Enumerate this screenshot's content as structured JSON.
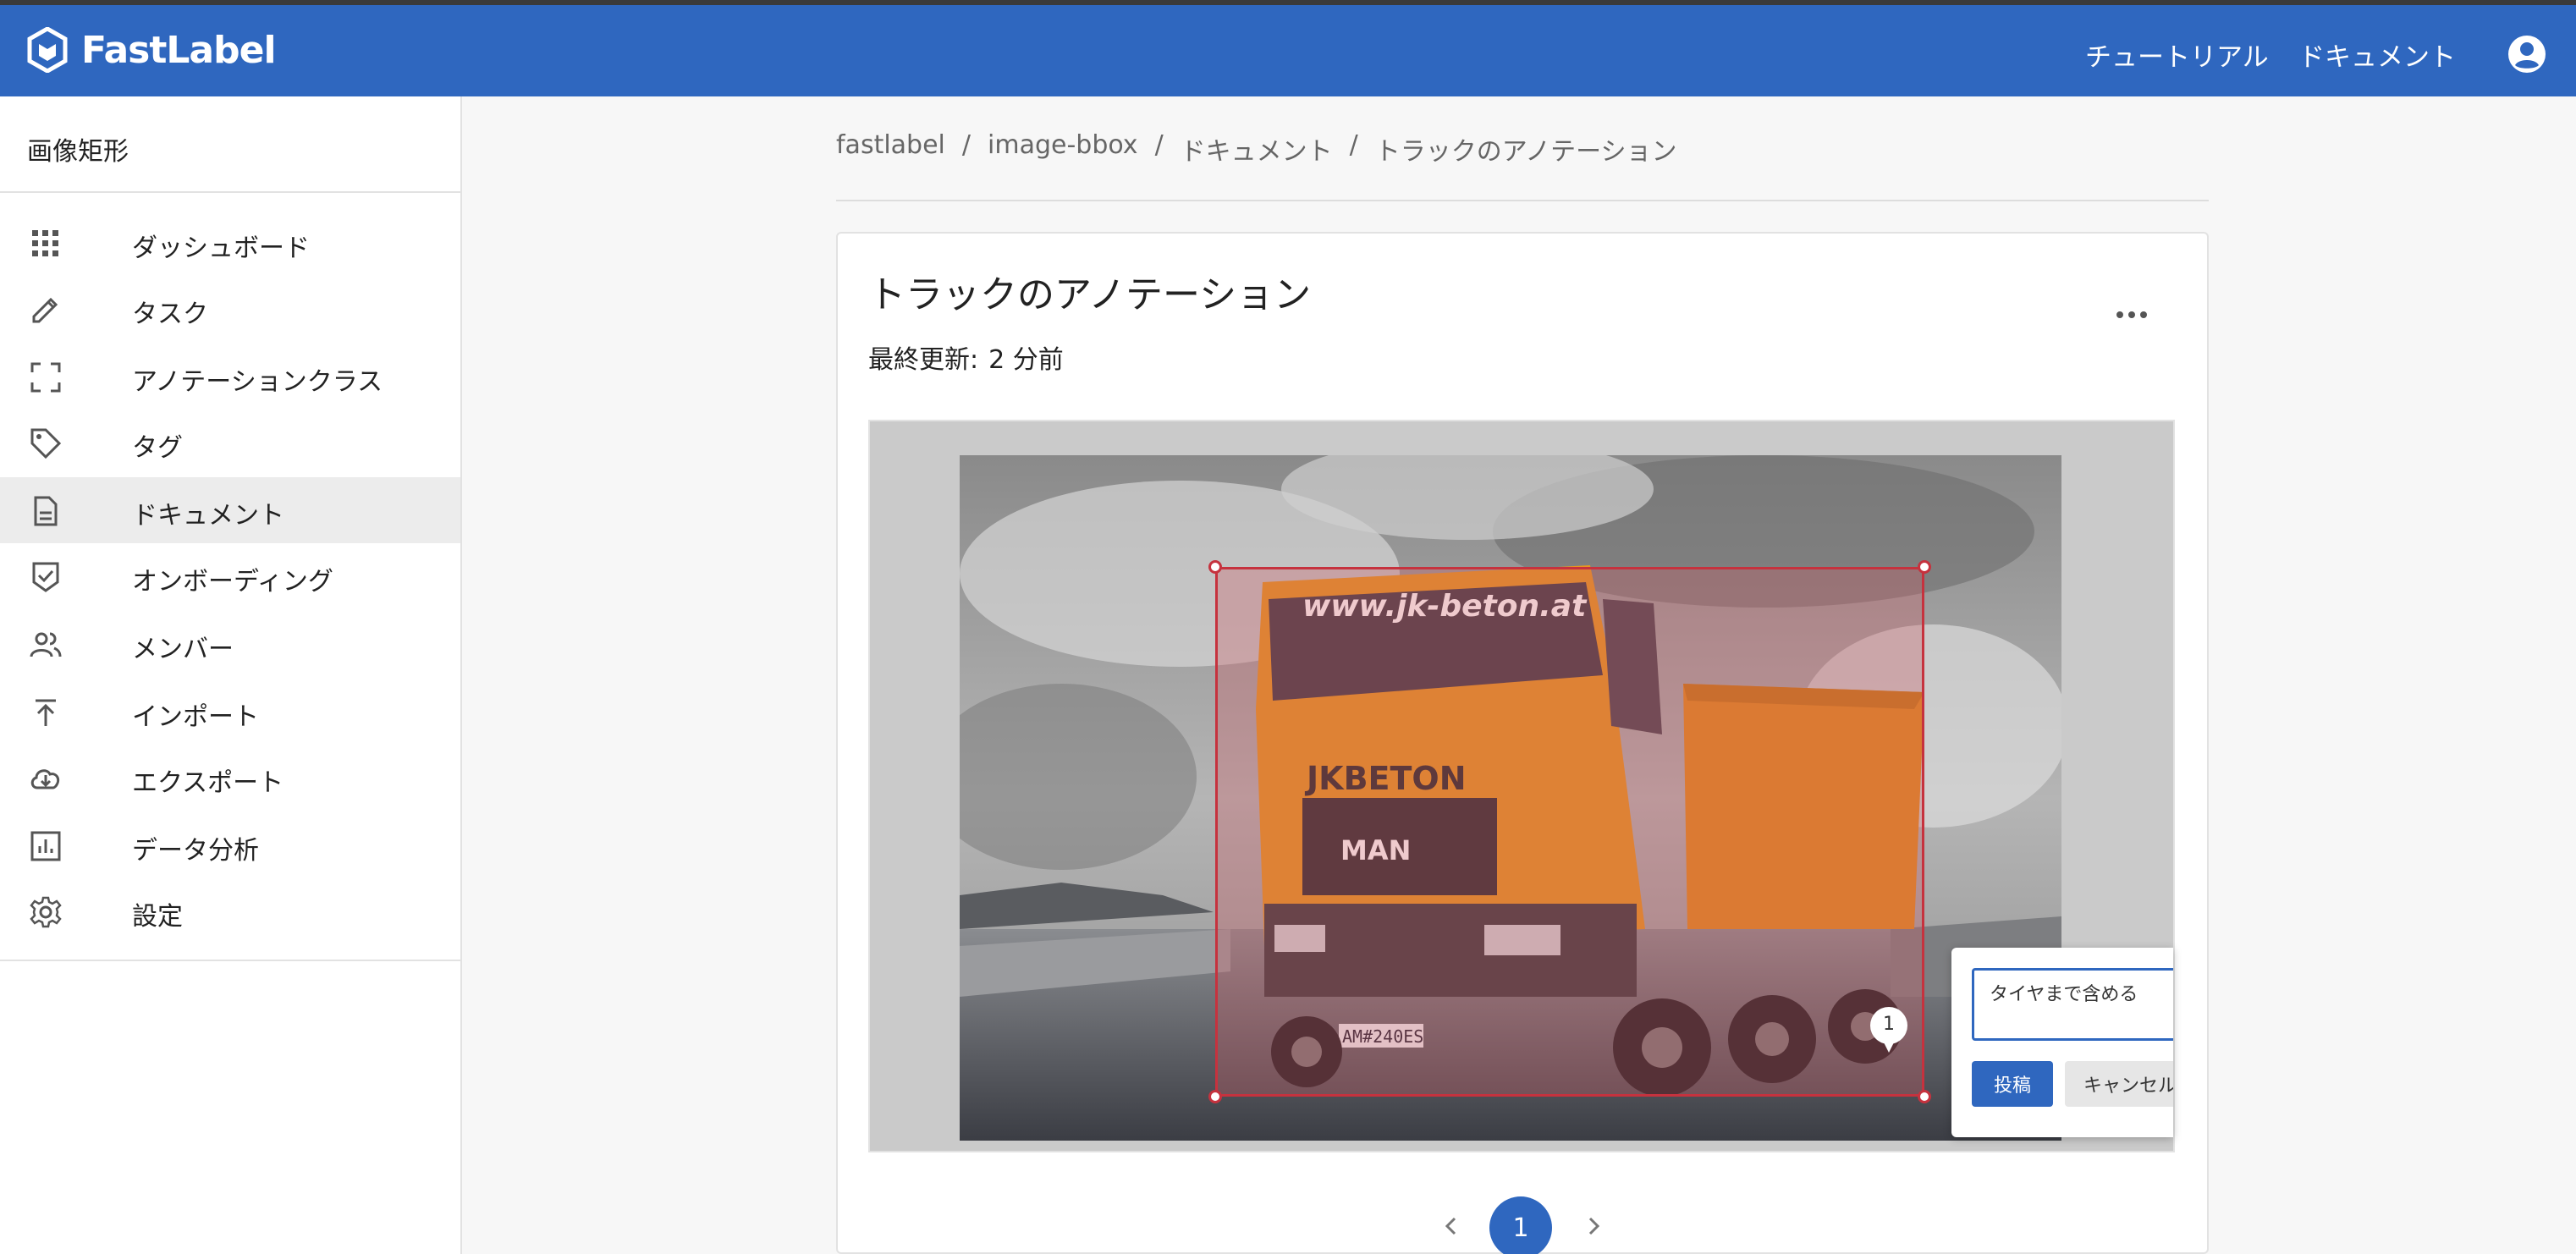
{
  "app": {
    "name": "FastLabel",
    "brand_color": "#2f67bf"
  },
  "header": {
    "tutorial_label": "チュートリアル",
    "docs_label": "ドキュメント",
    "account_icon": "account-circle-icon"
  },
  "sidebar": {
    "project_title": "画像矩形",
    "items": [
      {
        "label": "ダッシュボード",
        "icon": "grid-icon",
        "active": false
      },
      {
        "label": "タスク",
        "icon": "pencil-icon",
        "active": false
      },
      {
        "label": "アノテーションクラス",
        "icon": "frame-corners-icon",
        "active": false
      },
      {
        "label": "タグ",
        "icon": "tag-icon",
        "active": false
      },
      {
        "label": "ドキュメント",
        "icon": "document-icon",
        "active": true
      },
      {
        "label": "オンボーディング",
        "icon": "shield-check-icon",
        "active": false
      },
      {
        "label": "メンバー",
        "icon": "people-icon",
        "active": false
      },
      {
        "label": "インポート",
        "icon": "upload-icon",
        "active": false
      },
      {
        "label": "エクスポート",
        "icon": "cloud-download-icon",
        "active": false
      },
      {
        "label": "データ分析",
        "icon": "chart-icon",
        "active": false
      },
      {
        "label": "設定",
        "icon": "gear-icon",
        "active": false
      }
    ]
  },
  "breadcrumb": [
    "fastlabel",
    "image-bbox",
    "ドキュメント",
    "トラックのアノテーション"
  ],
  "document": {
    "title": "トラックのアノテーション",
    "updated_label": "最終更新:",
    "updated_value": "2 分前"
  },
  "annotation": {
    "box_color": "#c6323e",
    "comment_marker": "1",
    "comment_text": "タイヤまで含める",
    "post_label": "投稿",
    "cancel_label": "キャンセル"
  },
  "image": {
    "truck_url_text": "www.jk-beton.at",
    "truck_brand": "MAN",
    "truck_logo": "JKBETON",
    "plate": "AM#240ES"
  },
  "pagination": {
    "current_page": "1"
  }
}
